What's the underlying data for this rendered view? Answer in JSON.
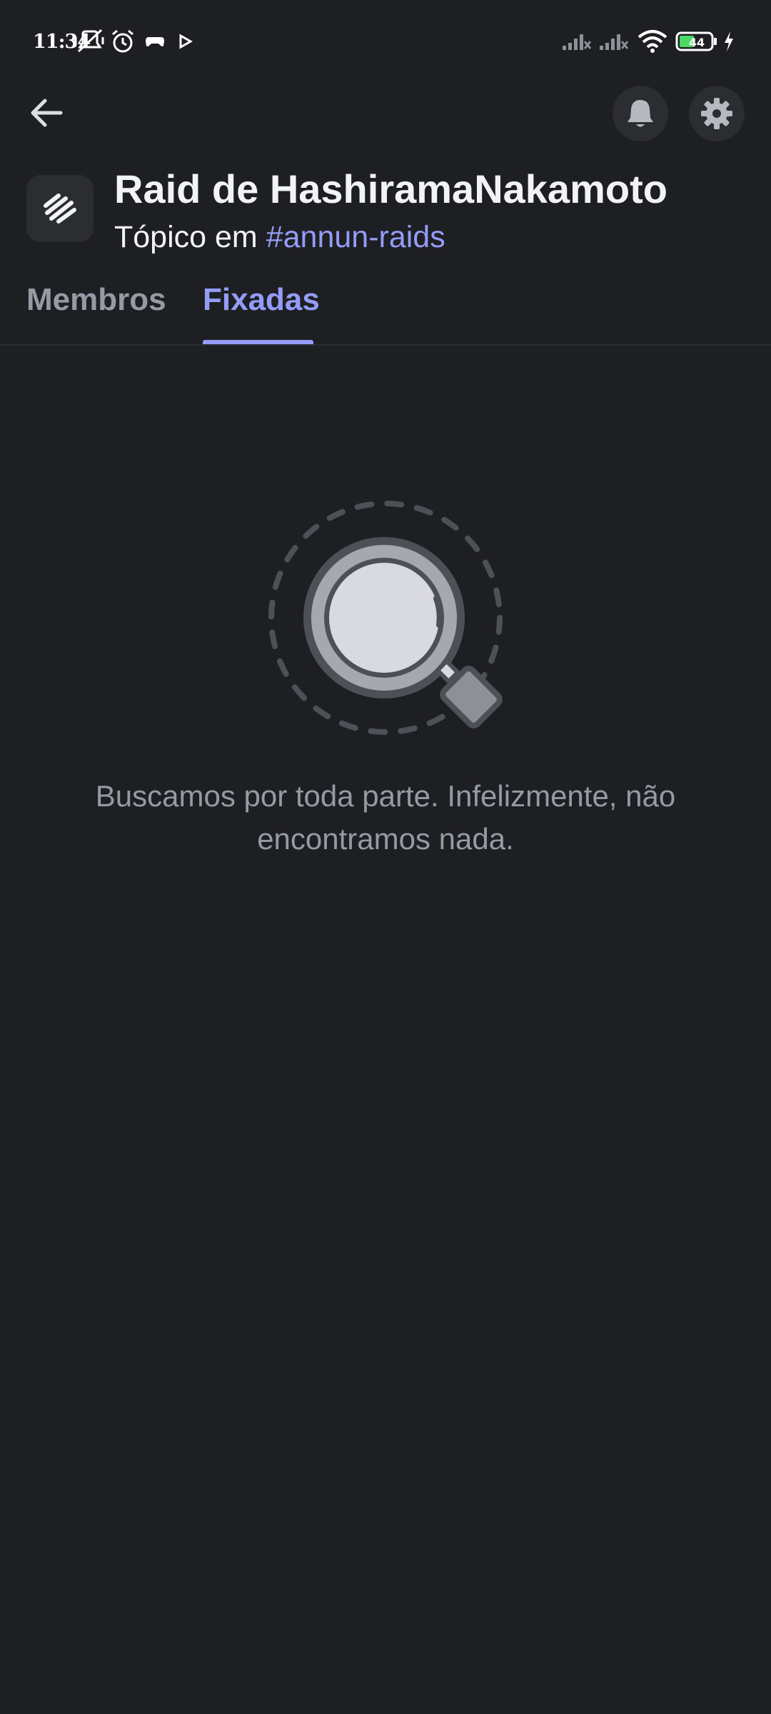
{
  "status_bar": {
    "time": "11:34",
    "battery_level": "44",
    "icons": [
      "mute-icon",
      "alarm-icon",
      "gamepad-icon",
      "play-icon",
      "signal-icon",
      "signal-icon",
      "wifi-icon",
      "battery-icon",
      "charging-icon"
    ]
  },
  "header": {
    "back_icon": "arrow-left-icon",
    "notifications_icon": "bell-icon",
    "settings_icon": "gear-icon",
    "thread_icon": "thread-icon",
    "title": "Raid de HashiramaNakamoto",
    "subtitle_prefix": "Tópico em ",
    "channel": "#annun-raids"
  },
  "tabs": [
    {
      "label": "Membros",
      "active": false
    },
    {
      "label": "Fixadas",
      "active": true
    }
  ],
  "empty_state": {
    "icon": "magnifier-icon",
    "message": "Buscamos por toda parte. Infelizmente, não encontramos nada."
  },
  "colors": {
    "background": "#1e1f23",
    "surface": "#2b2d31",
    "accent": "#949cf7",
    "muted_text": "#949ba4",
    "primary_text": "#f2f3f5"
  }
}
